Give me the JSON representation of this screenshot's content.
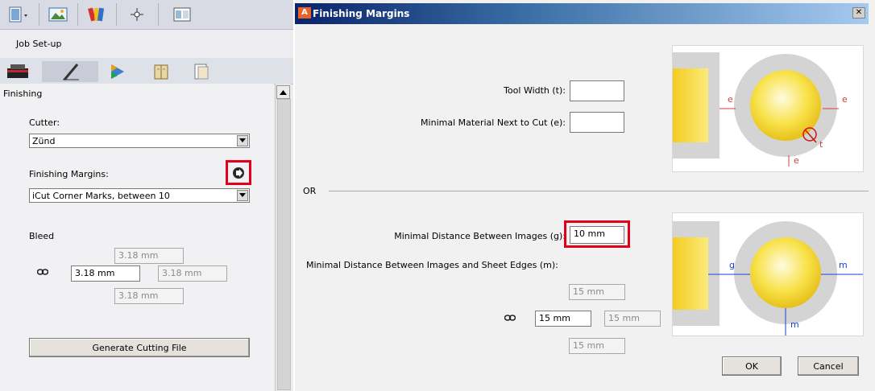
{
  "left_panel": {
    "section_title": "Job Set-up",
    "finishing_title": "Finishing",
    "cutter_label": "Cutter:",
    "cutter_value": "Zünd",
    "finishing_margins_label": "Finishing Margins:",
    "finishing_margins_value": "iCut Corner Marks, between 10",
    "bleed_label": "Bleed",
    "bleed": {
      "top": "3.18 mm",
      "left": "3.18 mm",
      "right": "3.18 mm",
      "bottom": "3.18 mm"
    },
    "generate_button": "Generate Cutting File"
  },
  "dialog": {
    "title": "Finishing Margins",
    "app_icon_text": "A",
    "tool_width_label": "Tool Width (t):",
    "tool_width_value": "",
    "min_material_label": "Minimal Material Next to Cut (e):",
    "min_material_value": "",
    "or_label": "OR",
    "min_distance_images_label": "Minimal Distance Between Images (g):",
    "min_distance_images_value": "10 mm",
    "min_distance_edges_label": "Minimal Distance Between Images and Sheet Edges (m):",
    "edges": {
      "top": "15 mm",
      "left": "15 mm",
      "right": "15 mm",
      "bottom": "15 mm"
    },
    "ok_label": "OK",
    "cancel_label": "Cancel",
    "diagram1_labels": {
      "e_left": "e",
      "e_right": "e",
      "e_bottom": "e",
      "t": "t"
    },
    "diagram2_labels": {
      "g": "g",
      "m_right": "m",
      "m_bottom": "m"
    }
  },
  "colors": {
    "title_bar": "#0a246a",
    "highlight": "#e0001a",
    "accent_blue": "#1a3fd0"
  }
}
